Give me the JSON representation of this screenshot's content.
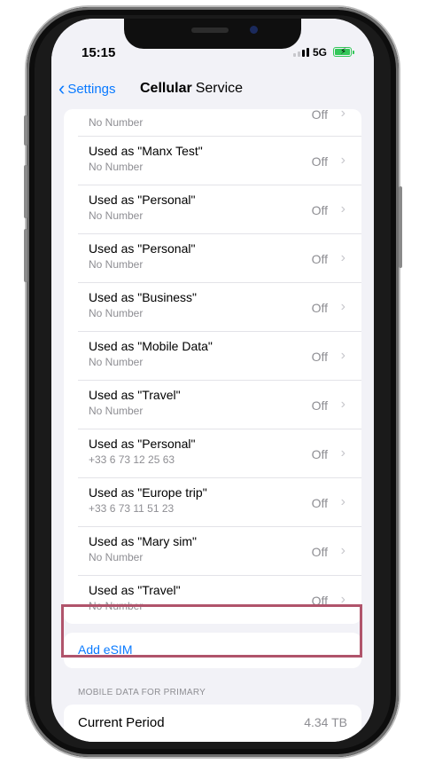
{
  "status": {
    "time": "15:15",
    "network": "5G"
  },
  "nav": {
    "back_label": "Settings",
    "title_word1": "Cellular",
    "title_word2": "Service"
  },
  "plans": {
    "partial_row": {
      "subtitle": "No Number",
      "value": "Off"
    },
    "rows": [
      {
        "title": "Used as \"Manx Test\"",
        "subtitle": "No Number",
        "value": "Off"
      },
      {
        "title": "Used as \"Personal\"",
        "subtitle": "No Number",
        "value": "Off"
      },
      {
        "title": "Used as \"Personal\"",
        "subtitle": "No Number",
        "value": "Off"
      },
      {
        "title": "Used as \"Business\"",
        "subtitle": "No Number",
        "value": "Off"
      },
      {
        "title": "Used as \"Mobile Data\"",
        "subtitle": "No Number",
        "value": "Off"
      },
      {
        "title": "Used as \"Travel\"",
        "subtitle": "No Number",
        "value": "Off"
      },
      {
        "title": "Used as \"Personal\"",
        "subtitle": "+33 6 73 12 25 63",
        "value": "Off"
      },
      {
        "title": "Used as \"Europe trip\"",
        "subtitle": "+33 6 73 11 51 23",
        "value": "Off"
      },
      {
        "title": "Used as \"Mary sim\"",
        "subtitle": "No Number",
        "value": "Off"
      },
      {
        "title": "Used as \"Travel\"",
        "subtitle": "No Number",
        "value": "Off"
      }
    ]
  },
  "add_esim_label": "Add eSIM",
  "mobile_data": {
    "section_header": "MOBILE DATA FOR PRIMARY",
    "current_period_label": "Current Period",
    "current_period_value": "4.34 TB"
  },
  "colors": {
    "accent": "#0a7aff",
    "highlight": "#b0546b",
    "battery": "#34c759"
  },
  "icons": {
    "back": "chevron-left-icon",
    "row": "chevron-right-icon",
    "battery": "battery-charging-icon",
    "signal": "signal-bars-icon"
  }
}
